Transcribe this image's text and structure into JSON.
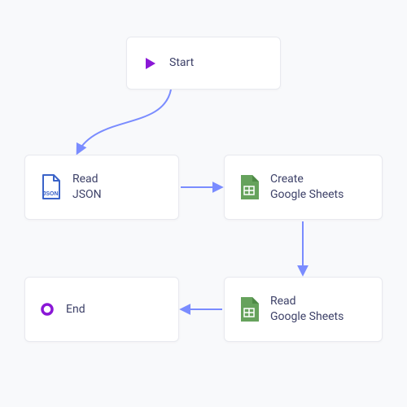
{
  "nodes": {
    "start": {
      "label": "Start",
      "icon": "play-icon"
    },
    "read_json": {
      "label": "Read\nJSON",
      "icon": "json-icon"
    },
    "create_sheets": {
      "label": "Create\nGoogle Sheets",
      "icon": "sheets-icon"
    },
    "read_sheets": {
      "label": "Read\nGoogle Sheets",
      "icon": "sheets-icon"
    },
    "end": {
      "label": "End",
      "icon": "end-icon"
    }
  },
  "edges": [
    {
      "from": "start",
      "to": "read_json"
    },
    {
      "from": "read_json",
      "to": "create_sheets"
    },
    {
      "from": "create_sheets",
      "to": "read_sheets"
    },
    {
      "from": "read_sheets",
      "to": "end"
    }
  ],
  "colors": {
    "connector": "#7a8cff",
    "purple": "#8a17d6",
    "json_blue": "#3a63c8",
    "sheets_green": "#66a25c",
    "node_text": "#3d4168"
  }
}
